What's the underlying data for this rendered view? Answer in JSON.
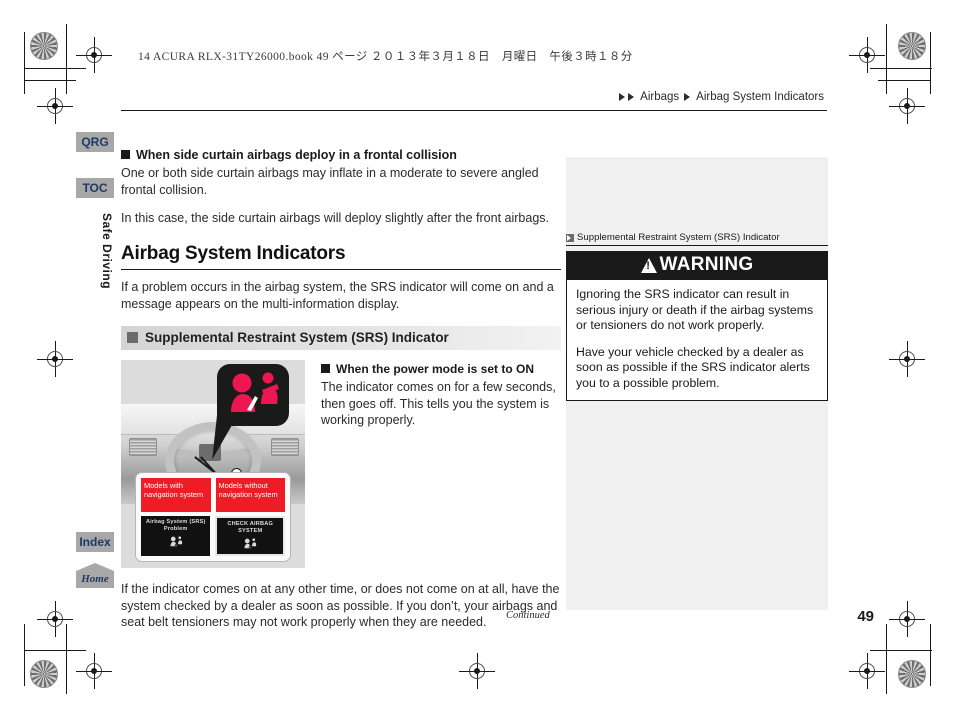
{
  "print_header": "14 ACURA RLX-31TY26000.book  49 ページ  ２０１３年３月１８日　月曜日　午後３時１８分",
  "breadcrumb": {
    "parent": "Airbags",
    "current": "Airbag System Indicators"
  },
  "sidebar_tabs": {
    "qrg": "QRG",
    "toc": "TOC",
    "section": "Safe Driving",
    "index": "Index",
    "home": "Home"
  },
  "main": {
    "subhead_1": "When side curtain airbags deploy in a frontal collision",
    "para_1": "One or both side curtain airbags may inflate in a moderate to severe angled frontal collision.",
    "para_2": "In this case, the side curtain airbags will deploy slightly after the front airbags.",
    "section_title": "Airbag System Indicators",
    "para_3": "If a problem occurs in the airbag system, the SRS indicator will come on and a message appears on the multi-information display.",
    "gray_head": "Supplemental Restraint System (SRS) Indicator",
    "subhead_2": "When the power mode is set to ON",
    "para_4": "The indicator comes on for a few seconds, then goes off. This tells you the system is working properly.",
    "para_5": "If the indicator comes on at any other time, or does not come on at all, have the system checked by a dealer as soon as possible. If you don’t, your airbags and seat belt tensioners may not work properly when they are needed."
  },
  "figure": {
    "label_with_nav": "Models with navigation system",
    "label_without_nav": "Models without navigation system",
    "screen_with_nav": "Airbag System (SRS) Problem",
    "screen_without_nav": "CHECK AIRBAG SYSTEM"
  },
  "side_panel": {
    "caption": "Supplemental Restraint System (SRS) Indicator",
    "warning_title": "WARNING",
    "warning_para_1": "Ignoring the SRS indicator can result in serious injury or death if the airbag systems or tensioners do not work properly.",
    "warning_para_2": "Have your vehicle checked by a dealer as soon as possible if the SRS indicator alerts you to a possible problem."
  },
  "footer": {
    "continued": "Continued",
    "page_number": "49"
  },
  "colors": {
    "red_label": "#ee1c25",
    "tab_gray": "#a8a8a8",
    "tab_text": "#1f3864",
    "side_panel": "#f0f0f0"
  }
}
